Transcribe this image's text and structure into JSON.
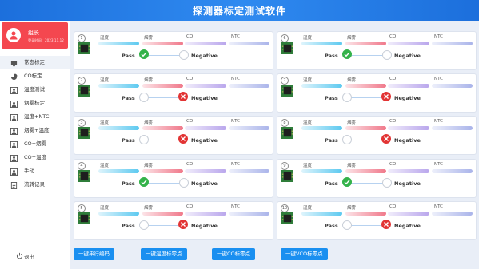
{
  "app": {
    "title": "探测器标定测试软件"
  },
  "user": {
    "name": "组长",
    "login_text": "登录时间：2023.11.12"
  },
  "menu": [
    {
      "label": "常态标定",
      "icon": "monitor-icon",
      "active": true
    },
    {
      "label": "CO标定",
      "icon": "pie-chart-icon"
    },
    {
      "label": "温度测试",
      "icon": "person-icon"
    },
    {
      "label": "烟雾标定",
      "icon": "person-icon"
    },
    {
      "label": "温度+NTC",
      "icon": "person-icon"
    },
    {
      "label": "烟雾+温度",
      "icon": "person-icon"
    },
    {
      "label": "CO+烟雾",
      "icon": "person-icon"
    },
    {
      "label": "CO+温度",
      "icon": "person-icon"
    },
    {
      "label": "手动",
      "icon": "person-icon"
    },
    {
      "label": "流转记录",
      "icon": "document-icon"
    }
  ],
  "logout_label": "退出",
  "sensor_labels": {
    "left": [
      "温度",
      "烟雾",
      "CO",
      "NTC"
    ],
    "right": [
      "温度",
      "烟雾",
      "CO",
      "NTC"
    ]
  },
  "colors": {
    "temp": "#5cc9f0",
    "smoke": "#f0788a",
    "co": "#b9a6ec",
    "ntc": "#aab4ea",
    "pass": "#34b24a",
    "fail": "#e23434",
    "accent": "#1a8ff0"
  },
  "cards": [
    {
      "num": "1",
      "labels": [
        "温度",
        "烟雾",
        "CO",
        "NTC"
      ],
      "result": "pass",
      "pass_label": "Pass",
      "neg_label": "Negative"
    },
    {
      "num": "2",
      "labels": [
        "温度",
        "烟雾",
        "CO",
        "NTC"
      ],
      "result": "fail",
      "pass_label": "Pass",
      "neg_label": "Negative"
    },
    {
      "num": "3",
      "labels": [
        "温度",
        "烟雾",
        "CO",
        "NTC"
      ],
      "result": "fail",
      "pass_label": "Pass",
      "neg_label": "Negative"
    },
    {
      "num": "4",
      "labels": [
        "温度",
        "烟雾",
        "CO",
        "NTC"
      ],
      "result": "pass",
      "pass_label": "Pass",
      "neg_label": "Negative"
    },
    {
      "num": "5",
      "labels": [
        "温度",
        "烟雾",
        "CO",
        "NTC"
      ],
      "result": "fail",
      "pass_label": "Pass",
      "neg_label": "Negative"
    },
    {
      "num": "6",
      "labels": [
        "温度",
        "烟雾",
        "CO",
        "NTC"
      ],
      "result": "pass",
      "pass_label": "Pass",
      "neg_label": "Negative"
    },
    {
      "num": "7",
      "labels": [
        "温度",
        "烟雾",
        "CO",
        "NTC"
      ],
      "result": "fail",
      "pass_label": "Pass",
      "neg_label": "Negative"
    },
    {
      "num": "8",
      "labels": [
        "温度",
        "烟雾",
        "CO",
        "NTC"
      ],
      "result": "fail",
      "pass_label": "Pass",
      "neg_label": "Negative"
    },
    {
      "num": "9",
      "labels": [
        "温度",
        "烟雾",
        "CO",
        "NTC"
      ],
      "result": "pass",
      "pass_label": "Pass",
      "neg_label": "Negative"
    },
    {
      "num": "10",
      "labels": [
        "温度",
        "烟雾",
        "CO",
        "NTC"
      ],
      "result": "fail",
      "pass_label": "Pass",
      "neg_label": "Negative"
    }
  ],
  "buttons": [
    "一键串行编码",
    "一键温度标零点",
    "一键CO标零点",
    "一键VCO标零点"
  ]
}
